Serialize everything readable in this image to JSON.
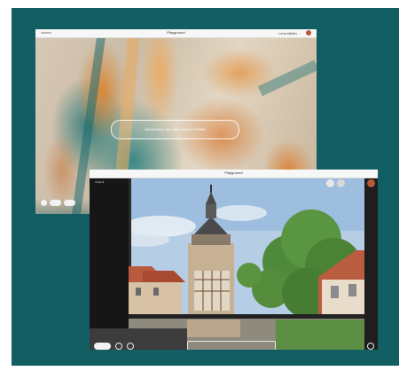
{
  "back_window": {
    "title": "Playground",
    "user": "Lena Müller",
    "prompt_placeholder": "Beschreiben Sie einen anderen Bildstil"
  },
  "front_window": {
    "title": "Playground",
    "top_left_text": "Original"
  },
  "colors": {
    "page_background": "#135e63",
    "avatar": "#b35a36",
    "accent_orange": "#d98634"
  },
  "icons": [
    "avatar",
    "circle-icon",
    "pill-button",
    "thumbnail-strip"
  ]
}
